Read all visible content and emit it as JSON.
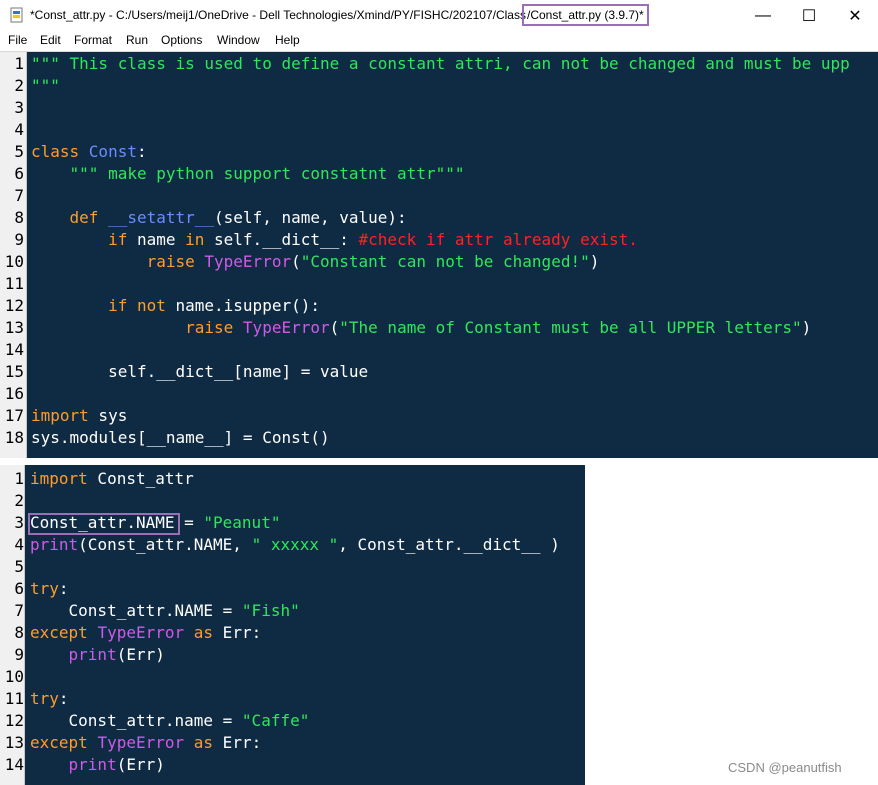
{
  "window": {
    "title_prefix": "*Const_attr.py - C:/Users/meij1/OneDrive - Dell Technologies/Xmind/PY/FISHC/202107/Class",
    "title_highlight": "/Const_attr.py (3.9.7)*",
    "minimize": "—",
    "maximize": "☐",
    "close": "✕"
  },
  "menu": [
    "File",
    "Edit",
    "Format",
    "Run",
    "Options",
    "Window",
    "Help"
  ],
  "pane1": [
    {
      "n": "1",
      "t": [
        [
          "str",
          "\"\"\" This class is used to define a constant attri, can not be changed and must be upp"
        ]
      ]
    },
    {
      "n": "2",
      "t": [
        [
          "str",
          "\"\"\""
        ]
      ]
    },
    {
      "n": "3",
      "t": []
    },
    {
      "n": "4",
      "t": []
    },
    {
      "n": "5",
      "t": [
        [
          "kw",
          "class "
        ],
        [
          "cls",
          "Const"
        ],
        [
          "",
          ":"
        ]
      ]
    },
    {
      "n": "6",
      "t": [
        [
          "",
          "    "
        ],
        [
          "str",
          "\"\"\" make python support constatnt attr\"\"\""
        ]
      ]
    },
    {
      "n": "7",
      "t": []
    },
    {
      "n": "8",
      "t": [
        [
          "",
          "    "
        ],
        [
          "kw",
          "def "
        ],
        [
          "fn",
          "__setattr__"
        ],
        [
          "",
          "(self, name, value):"
        ]
      ]
    },
    {
      "n": "9",
      "t": [
        [
          "",
          "        "
        ],
        [
          "kw",
          "if"
        ],
        [
          "",
          " name "
        ],
        [
          "kw",
          "in"
        ],
        [
          "",
          " self.__dict__: "
        ],
        [
          "cmt",
          "#check if attr already exist."
        ]
      ]
    },
    {
      "n": "10",
      "t": [
        [
          "",
          "            "
        ],
        [
          "kw",
          "raise "
        ],
        [
          "bi",
          "TypeError"
        ],
        [
          "",
          "("
        ],
        [
          "str",
          "\"Constant can not be changed!\""
        ],
        [
          "",
          ")"
        ]
      ]
    },
    {
      "n": "11",
      "t": []
    },
    {
      "n": "12",
      "t": [
        [
          "",
          "        "
        ],
        [
          "kw",
          "if not"
        ],
        [
          "",
          " name.isupper():"
        ]
      ]
    },
    {
      "n": "13",
      "t": [
        [
          "",
          "                "
        ],
        [
          "kw",
          "raise "
        ],
        [
          "bi",
          "TypeError"
        ],
        [
          "",
          "("
        ],
        [
          "str",
          "\"The name of Constant must be all UPPER letters\""
        ],
        [
          "",
          ")"
        ]
      ]
    },
    {
      "n": "14",
      "t": []
    },
    {
      "n": "15",
      "t": [
        [
          "",
          "        self.__dict__[name] = value"
        ]
      ]
    },
    {
      "n": "16",
      "t": []
    },
    {
      "n": "17",
      "t": [
        [
          "kw",
          "import"
        ],
        [
          "",
          " sys"
        ]
      ]
    },
    {
      "n": "18",
      "t": [
        [
          "",
          "sys.modules[__name__] = Const()"
        ]
      ]
    }
  ],
  "pane2": [
    {
      "n": "1",
      "t": [
        [
          "kw",
          "import"
        ],
        [
          "",
          " Const_attr"
        ]
      ]
    },
    {
      "n": "2",
      "t": []
    },
    {
      "n": "3",
      "t": [
        [
          "",
          "Const_attr.NAME = "
        ],
        [
          "str",
          "\"Peanut\""
        ]
      ]
    },
    {
      "n": "4",
      "t": [
        [
          "bi",
          "print"
        ],
        [
          "",
          "(Const_attr.NAME, "
        ],
        [
          "str",
          "\" xxxxx \""
        ],
        [
          "",
          ", Const_attr.__dict__ )"
        ]
      ]
    },
    {
      "n": "5",
      "t": []
    },
    {
      "n": "6",
      "t": [
        [
          "kw",
          "try"
        ],
        [
          "",
          ":"
        ]
      ]
    },
    {
      "n": "7",
      "t": [
        [
          "",
          "    Const_attr.NAME = "
        ],
        [
          "str",
          "\"Fish\""
        ]
      ]
    },
    {
      "n": "8",
      "t": [
        [
          "kw",
          "except "
        ],
        [
          "bi",
          "TypeError"
        ],
        [
          "kw",
          " as"
        ],
        [
          "",
          " Err:"
        ]
      ]
    },
    {
      "n": "9",
      "t": [
        [
          "",
          "    "
        ],
        [
          "bi",
          "print"
        ],
        [
          "",
          "(Err)"
        ]
      ]
    },
    {
      "n": "10",
      "t": []
    },
    {
      "n": "11",
      "t": [
        [
          "kw",
          "try"
        ],
        [
          "",
          ":"
        ]
      ]
    },
    {
      "n": "12",
      "t": [
        [
          "",
          "    Const_attr.name = "
        ],
        [
          "str",
          "\"Caffe\""
        ]
      ]
    },
    {
      "n": "13",
      "t": [
        [
          "kw",
          "except "
        ],
        [
          "bi",
          "TypeError"
        ],
        [
          "kw",
          " as"
        ],
        [
          "",
          " Err:"
        ]
      ]
    },
    {
      "n": "14",
      "t": [
        [
          "",
          "    "
        ],
        [
          "bi",
          "print"
        ],
        [
          "",
          "(Err)"
        ]
      ]
    }
  ],
  "watermark": "CSDN @peanutfish"
}
